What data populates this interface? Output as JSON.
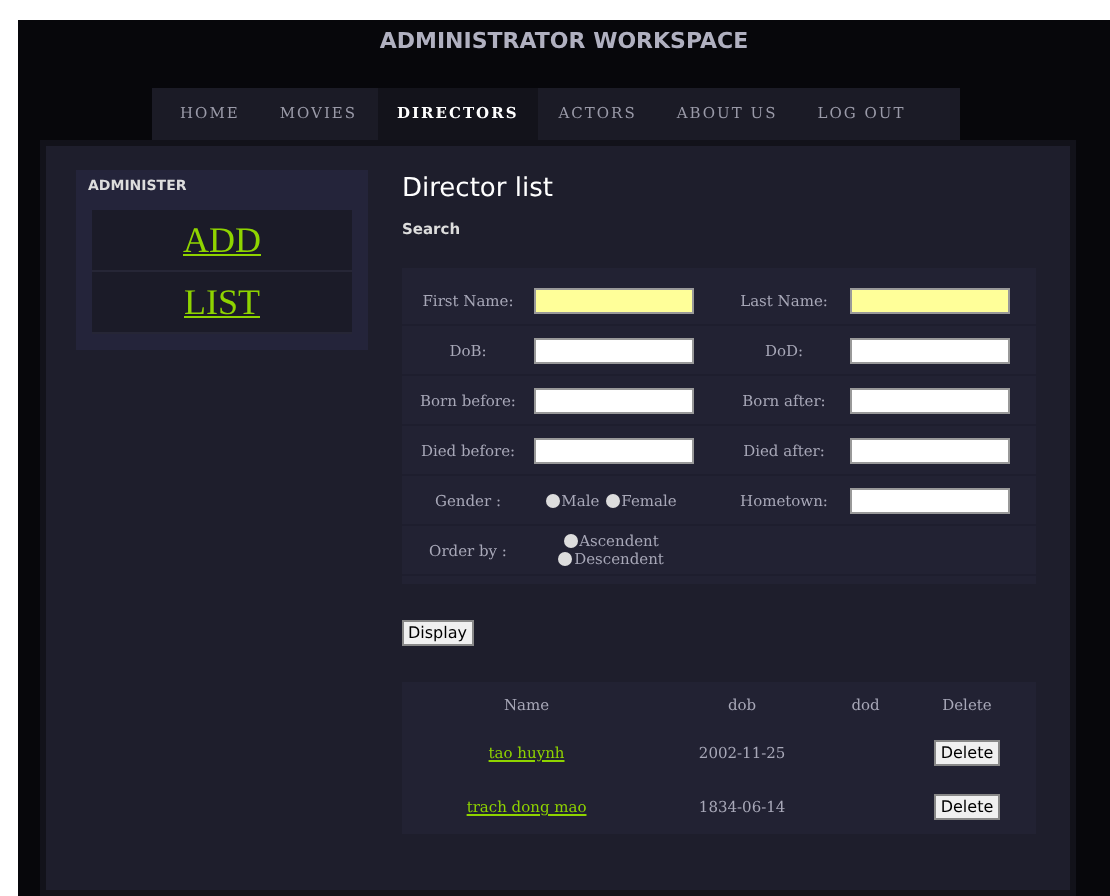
{
  "header": {
    "title": "ADMINISTRATOR WORKSPACE"
  },
  "nav": [
    {
      "label": "HOME",
      "selected": false
    },
    {
      "label": "MOVIES",
      "selected": false
    },
    {
      "label": "DIRECTORS",
      "selected": true
    },
    {
      "label": "ACTORS",
      "selected": false
    },
    {
      "label": "ABOUT US",
      "selected": false
    },
    {
      "label": "LOG OUT",
      "selected": false
    }
  ],
  "sidebar": {
    "title": "ADMINISTER",
    "links": [
      "ADD",
      "LIST"
    ]
  },
  "content": {
    "heading": "Director list",
    "subheading": "Search"
  },
  "search_rows": [
    [
      {
        "kind": "field",
        "label": "First Name:",
        "highlighted": true
      },
      {
        "kind": "field",
        "label": "Last Name:",
        "highlighted": true
      }
    ],
    [
      {
        "kind": "field",
        "label": "DoB:",
        "highlighted": false
      },
      {
        "kind": "field",
        "label": "DoD:",
        "highlighted": false
      }
    ],
    [
      {
        "kind": "field",
        "label": "Born before:",
        "highlighted": false
      },
      {
        "kind": "field",
        "label": "Born after:",
        "highlighted": false
      }
    ],
    [
      {
        "kind": "field",
        "label": "Died before:",
        "highlighted": false
      },
      {
        "kind": "field",
        "label": "Died after:",
        "highlighted": false
      }
    ],
    [
      {
        "kind": "radios",
        "label": "Gender :",
        "options": [
          {
            "label": "Male",
            "checked": false
          },
          {
            "label": "Female",
            "checked": false
          }
        ]
      },
      {
        "kind": "field",
        "label": "Hometown:",
        "highlighted": false
      }
    ],
    [
      {
        "kind": "radios",
        "label": "Order by :",
        "options": [
          {
            "label": "Ascendent",
            "checked": false
          },
          {
            "label": "Descendent",
            "checked": false
          }
        ]
      }
    ]
  ],
  "display_button": "Display",
  "table": {
    "columns": [
      "Name",
      "dob",
      "dod",
      "Delete"
    ],
    "rows": [
      {
        "name": "tao huynh",
        "dob": "2002-11-25",
        "dod": "",
        "action": "Delete"
      },
      {
        "name": "trach dong mao",
        "dob": "1834-06-14",
        "dod": "",
        "action": "Delete"
      }
    ]
  }
}
